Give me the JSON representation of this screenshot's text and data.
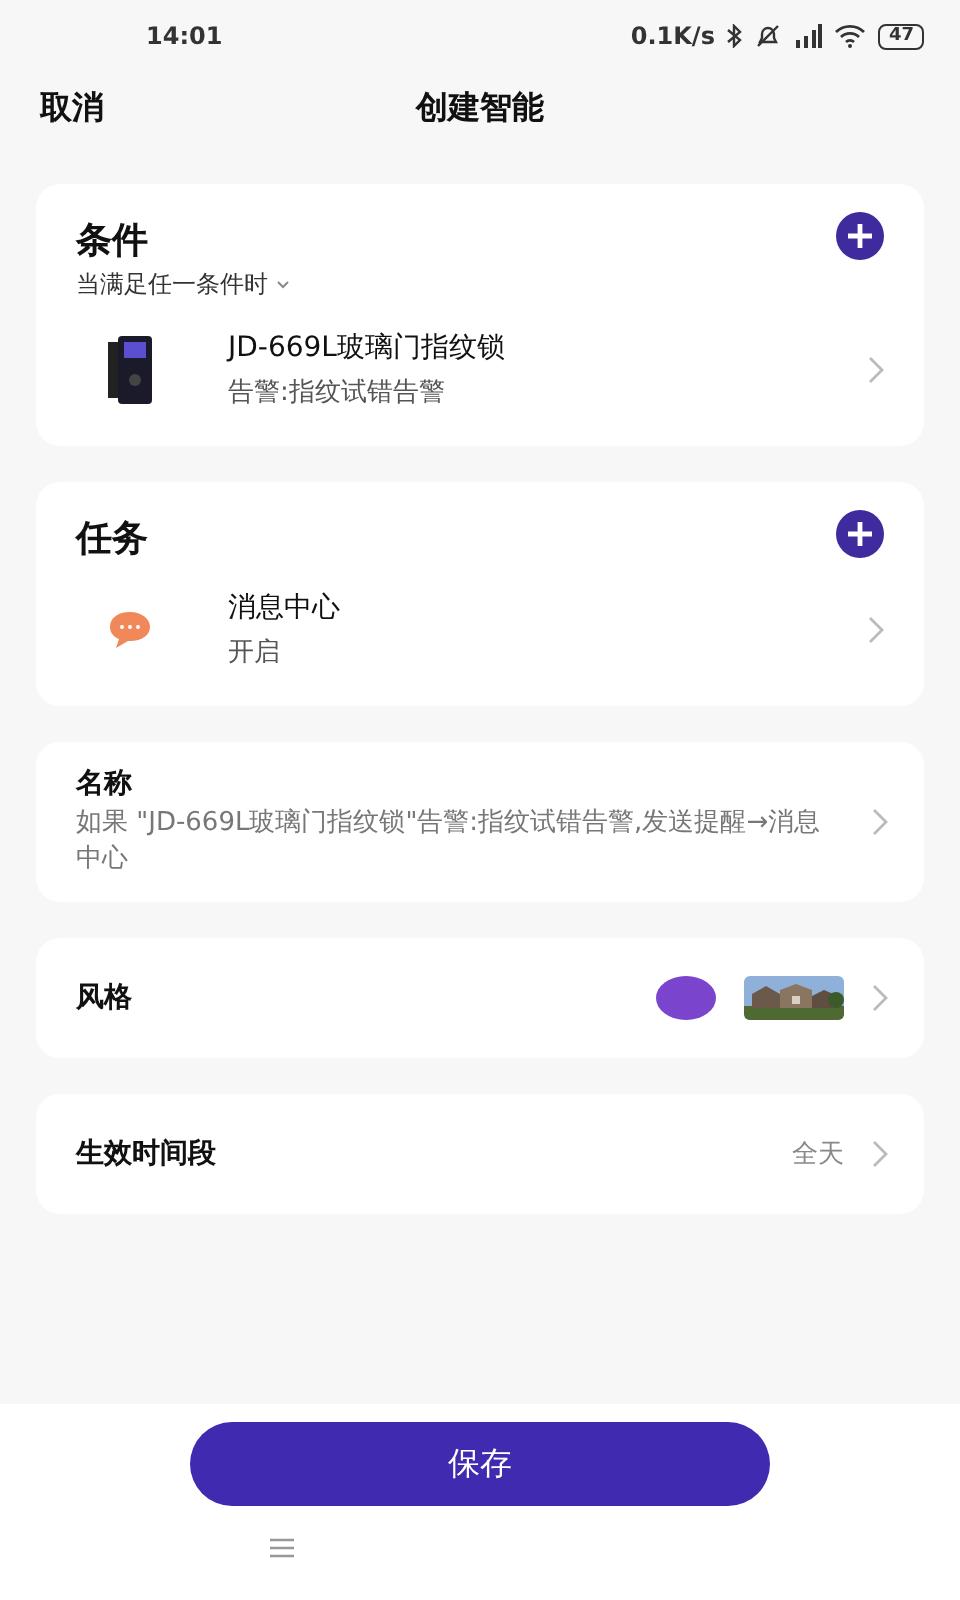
{
  "status_bar": {
    "time": "14:01",
    "net_speed": "0.1K/s",
    "battery": "47"
  },
  "header": {
    "cancel": "取消",
    "title": "创建智能"
  },
  "conditions": {
    "title": "条件",
    "mode": "当满足任一条件时",
    "items": [
      {
        "kind": "lock",
        "name": "JD-669L玻璃门指纹锁",
        "detail": "告警:指纹试错告警"
      }
    ]
  },
  "tasks": {
    "title": "任务",
    "items": [
      {
        "kind": "message",
        "name": "消息中心",
        "detail": "开启"
      }
    ]
  },
  "name_row": {
    "label": "名称",
    "value": "如果 \"JD-669L玻璃门指纹锁\"告警:指纹试错告警,发送提醒→消息中心"
  },
  "style_row": {
    "label": "风格",
    "color": "#7a45cc"
  },
  "time_row": {
    "label": "生效时间段",
    "value": "全天"
  },
  "save_button": "保存"
}
